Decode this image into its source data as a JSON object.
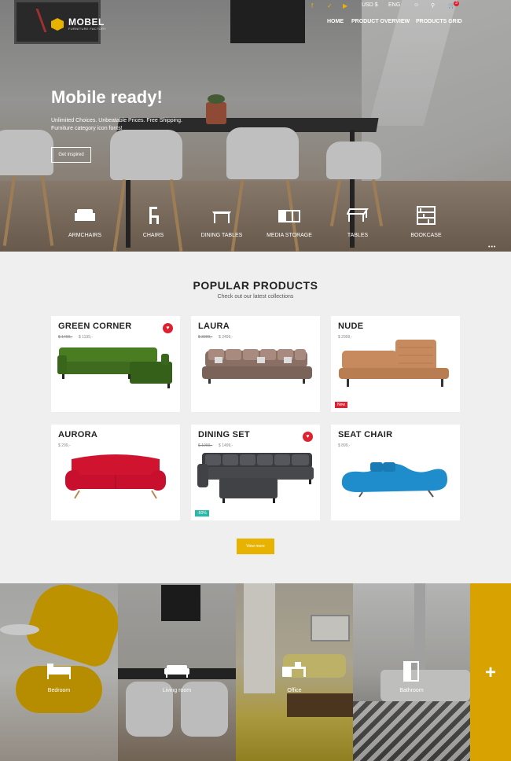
{
  "brand": {
    "name": "MOBEL",
    "tagline": "FURNITURE FACTORY"
  },
  "topbar": {
    "social_icons": [
      "facebook-icon",
      "twitter-icon",
      "youtube-icon"
    ],
    "currency": "USD $",
    "language": "ENG",
    "cart_count": "3"
  },
  "menu": [
    "HOME",
    "PRODUCT OVERVIEW",
    "PRODUCTS GRID"
  ],
  "hero": {
    "title": "Mobile ready!",
    "subtitle": "Unlimited Choices. Unbeatable Prices. Free Shipping. Furniture category icon fonts!",
    "button": "Get inspired"
  },
  "categories": [
    {
      "label": "ARMCHAIRS",
      "icon": "armchair-icon"
    },
    {
      "label": "CHAIRS",
      "icon": "chair-icon"
    },
    {
      "label": "DINING TABLES",
      "icon": "dining-table-icon"
    },
    {
      "label": "MEDIA STORAGE",
      "icon": "media-storage-icon"
    },
    {
      "label": "TABLES",
      "icon": "table-icon"
    },
    {
      "label": "BOOKCASE",
      "icon": "bookcase-icon"
    }
  ],
  "popular": {
    "title": "POPULAR PRODUCTS",
    "subtitle": "Check out our latest collections",
    "button": "View more"
  },
  "products": [
    {
      "name": "GREEN CORNER",
      "old_price": "$ 1499,-",
      "price": "$ 1199,-",
      "favorite": true,
      "badge": "",
      "color": "#3f6b1e"
    },
    {
      "name": "LAURA",
      "old_price": "$ 3999,-",
      "price": "$ 3499,-",
      "favorite": false,
      "badge": "",
      "color": "#7a6358"
    },
    {
      "name": "NUDE",
      "old_price": "",
      "price": "$ 2999,-",
      "favorite": false,
      "badge": "New",
      "color": "#c68a5e"
    },
    {
      "name": "AURORA",
      "old_price": "",
      "price": "$ 299,-",
      "favorite": false,
      "badge": "",
      "color": "#c8102e"
    },
    {
      "name": "DINING SET",
      "old_price": "$ 1999,-",
      "price": "$ 1499,-",
      "favorite": true,
      "badge": "-50%",
      "color": "#46484c"
    },
    {
      "name": "SEAT CHAIR",
      "old_price": "",
      "price": "$ 899,-",
      "favorite": false,
      "badge": "",
      "color": "#1f8ccc"
    }
  ],
  "rooms": [
    {
      "label": "Bedroom",
      "icon": "bed-icon"
    },
    {
      "label": "Living room",
      "icon": "sofa-icon"
    },
    {
      "label": "Office",
      "icon": "desk-icon"
    },
    {
      "label": "Bathroom",
      "icon": "bathroom-icon"
    }
  ],
  "rooms_more": "+",
  "colors": {
    "accent": "#e7b300",
    "badge_red": "#e0202f",
    "badge_teal": "#27b8a8"
  }
}
